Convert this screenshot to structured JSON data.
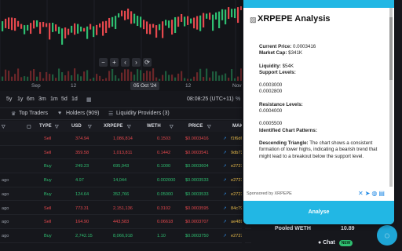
{
  "chart": {
    "x_labels": [
      "Sep",
      "12",
      "Nov",
      "12"
    ],
    "hovered_date": "05 Oct '24",
    "zoom_controls": [
      "−",
      "+",
      "‹",
      "›",
      "⟳"
    ]
  },
  "timeframes": {
    "items": [
      "5y",
      "1y",
      "6m",
      "3m",
      "1m",
      "5d",
      "1d"
    ],
    "time": "08:08:25 (UTC+11)",
    "mode": "%",
    "scale": "log"
  },
  "tabs": {
    "top_traders": "Top Traders",
    "holders": "Holders (909)",
    "liquidity": "Liquidity Providers (3)"
  },
  "table": {
    "headers": [
      "TYPE",
      "USD",
      "XRPEPE",
      "WETH",
      "PRICE",
      "MAK"
    ],
    "rows": [
      {
        "age": "",
        "type": "Sell",
        "usd": "374.94",
        "xrpepe": "1,086,814",
        "weth": "0.1503",
        "price": "$0.0003416",
        "maker": "f1f6d6"
      },
      {
        "age": "",
        "type": "Sell",
        "usd": "359.58",
        "xrpepe": "1,013,811",
        "weth": "0.1442",
        "price": "$0.0003541",
        "maker": "9db731"
      },
      {
        "age": "",
        "type": "Buy",
        "usd": "249.23",
        "xrpepe": "695,943",
        "weth": "0.1000",
        "price": "$0.0003604",
        "maker": "e2727"
      },
      {
        "age": "ago",
        "type": "Buy",
        "usd": "4.97",
        "xrpepe": "14,044",
        "weth": "0.002000",
        "price": "$0.0003533",
        "maker": "e2727"
      },
      {
        "age": "ago",
        "type": "Buy",
        "usd": "124.64",
        "xrpepe": "352,766",
        "weth": "0.05000",
        "price": "$0.0003533",
        "maker": "e2727"
      },
      {
        "age": "ago",
        "type": "Sell",
        "usd": "773.31",
        "xrpepe": "2,151,136",
        "weth": "0.3102",
        "price": "$0.0003595",
        "maker": "84c79"
      },
      {
        "age": "ago",
        "type": "Sell",
        "usd": "164.90",
        "xrpepe": "443,583",
        "weth": "0.06618",
        "price": "$0.0003707",
        "maker": "ae489"
      },
      {
        "age": "ago",
        "type": "Buy",
        "usd": "2,742.15",
        "xrpepe": "8,066,918",
        "weth": "1.10",
        "price": "$0.0003750",
        "maker": "e2727"
      }
    ]
  },
  "pooled": {
    "label": "Pooled WETH",
    "value": "10.89"
  },
  "chat": {
    "label": "Chat",
    "badge": "NEW"
  },
  "panel": {
    "title": "XRPEPE Analysis",
    "current_price_label": "Current Price:",
    "current_price": "0.0003416",
    "market_cap_label": "Market Cap:",
    "market_cap": "$341K",
    "liquidity_label": "Liquidity:",
    "liquidity": "$54K",
    "support_label": "Support Levels:",
    "support_1": "0.0003000",
    "support_2": "0.0002800",
    "resistance_label": "Resistance Levels:",
    "resistance_1": "0.0004000",
    "resistance_2": "0.0005500",
    "patterns_label": "Identified Chart Patterns:",
    "pattern_name": "Descending Triangle:",
    "pattern_text": "The chart shows a consistent formation of lower highs, indicating a bearish trend that might lead to a breakout below the support level.",
    "sponsor": "Sponsored by XRPEPE",
    "analyse": "Analyse"
  }
}
